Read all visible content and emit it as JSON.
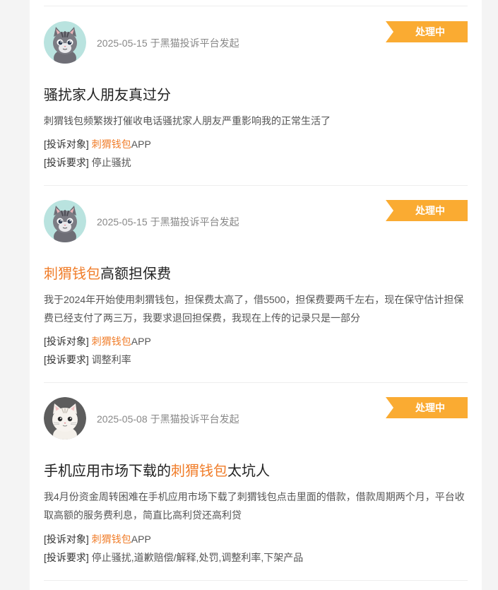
{
  "complaints": [
    {
      "date": "2025-05-15",
      "source": "于黑猫投诉平台发起",
      "status": "处理中",
      "title_prefix": "骚扰家人朋友真过分",
      "title_highlight": "",
      "title_suffix": "",
      "description": "刺猬钱包频繁拨打催收电话骚扰家人朋友严重影响我的正常生活了",
      "target_label": "[投诉对象]",
      "target_highlight": "刺猬钱包",
      "target_suffix": "APP",
      "demand_label": "[投诉要求]",
      "demand": "停止骚扰",
      "avatar_icon": "gray-tabby-cat-avatar-icon"
    },
    {
      "date": "2025-05-15",
      "source": "于黑猫投诉平台发起",
      "status": "处理中",
      "title_prefix": "",
      "title_highlight": "刺猬钱包",
      "title_suffix": "高额担保费",
      "description": "我于2024年开始使用刺猬钱包，担保费太高了，借5500，担保费要两千左右，现在保守估计担保费已经支付了两三万，我要求退回担保费，我现在上传的记录只是一部分",
      "target_label": "[投诉对象]",
      "target_highlight": "刺猬钱包",
      "target_suffix": "APP",
      "demand_label": "[投诉要求]",
      "demand": "调整利率",
      "avatar_icon": "gray-tabby-cat-avatar-icon"
    },
    {
      "date": "2025-05-08",
      "source": "于黑猫投诉平台发起",
      "status": "处理中",
      "title_prefix": "手机应用市场下载的",
      "title_highlight": "刺猬钱包",
      "title_suffix": "太坑人",
      "description": "我4月份资金周转困难在手机应用市场下载了刺猬钱包点击里面的借款，借款周期两个月，平台收取高额的服务费利息，简直比高利贷还高利贷",
      "target_label": "[投诉对象]",
      "target_highlight": "刺猬钱包",
      "target_suffix": "APP",
      "demand_label": "[投诉要求]",
      "demand": "停止骚扰,道歉赔偿/解释,处罚,调整利率,下架产品",
      "avatar_icon": "white-cat-avatar-icon"
    }
  ],
  "colors": {
    "status_badge": "#faab32",
    "highlight": "#f07d2a",
    "page_background": "#f4f4f4"
  }
}
